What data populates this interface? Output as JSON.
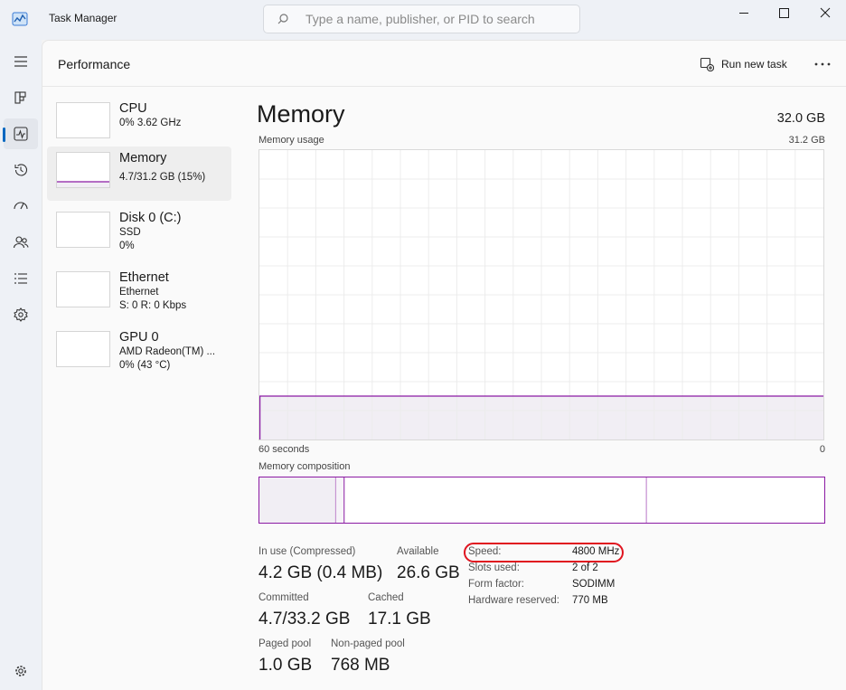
{
  "app": {
    "title": "Task Manager",
    "search_placeholder": "Type a name, publisher, or PID to search"
  },
  "header": {
    "title": "Performance",
    "run_new_task": "Run new task"
  },
  "rail": [
    "hamburger-menu",
    "processes",
    "performance",
    "app-history",
    "startup-apps",
    "users",
    "details",
    "services",
    "settings"
  ],
  "devices": [
    {
      "name": "CPU",
      "line1": "0% 3.62 GHz",
      "line2": ""
    },
    {
      "name": "Memory",
      "line1": "4.7/31.2 GB (15%)",
      "line2": ""
    },
    {
      "name": "Disk 0 (C:)",
      "line1": "SSD",
      "line2": "0%"
    },
    {
      "name": "Ethernet",
      "line1": "Ethernet",
      "line2": "S: 0 R: 0 Kbps"
    },
    {
      "name": "GPU 0",
      "line1": "AMD Radeon(TM) ...",
      "line2": "0% (43 °C)"
    }
  ],
  "memory": {
    "title": "Memory",
    "total": "32.0 GB",
    "usage_label": "Memory usage",
    "usage_max": "31.2 GB",
    "time_left": "60 seconds",
    "time_right": "0",
    "composition_label": "Memory composition",
    "usage_fraction": 0.15,
    "composition": {
      "in_use_fraction": 0.135,
      "modified_fraction": 0.015,
      "standby_fraction": 0.535
    },
    "stats": {
      "in_use_label": "In use (Compressed)",
      "in_use_value": "4.2 GB (0.4 MB)",
      "available_label": "Available",
      "available_value": "26.6 GB",
      "committed_label": "Committed",
      "committed_value": "4.7/33.2 GB",
      "cached_label": "Cached",
      "cached_value": "17.1 GB",
      "paged_label": "Paged pool",
      "paged_value": "1.0 GB",
      "nonpaged_label": "Non-paged pool",
      "nonpaged_value": "768 MB"
    },
    "props": {
      "speed_label": "Speed:",
      "speed_value": "4800 MHz",
      "slots_label": "Slots used:",
      "slots_value": "2 of 2",
      "form_label": "Form factor:",
      "form_value": "SODIMM",
      "reserved_label": "Hardware reserved:",
      "reserved_value": "770 MB"
    }
  },
  "colors": {
    "accent": "#0067c0",
    "memory": "#8b1aa3",
    "memory_fill": "#f1eef4",
    "annotation": "#e0141f"
  }
}
